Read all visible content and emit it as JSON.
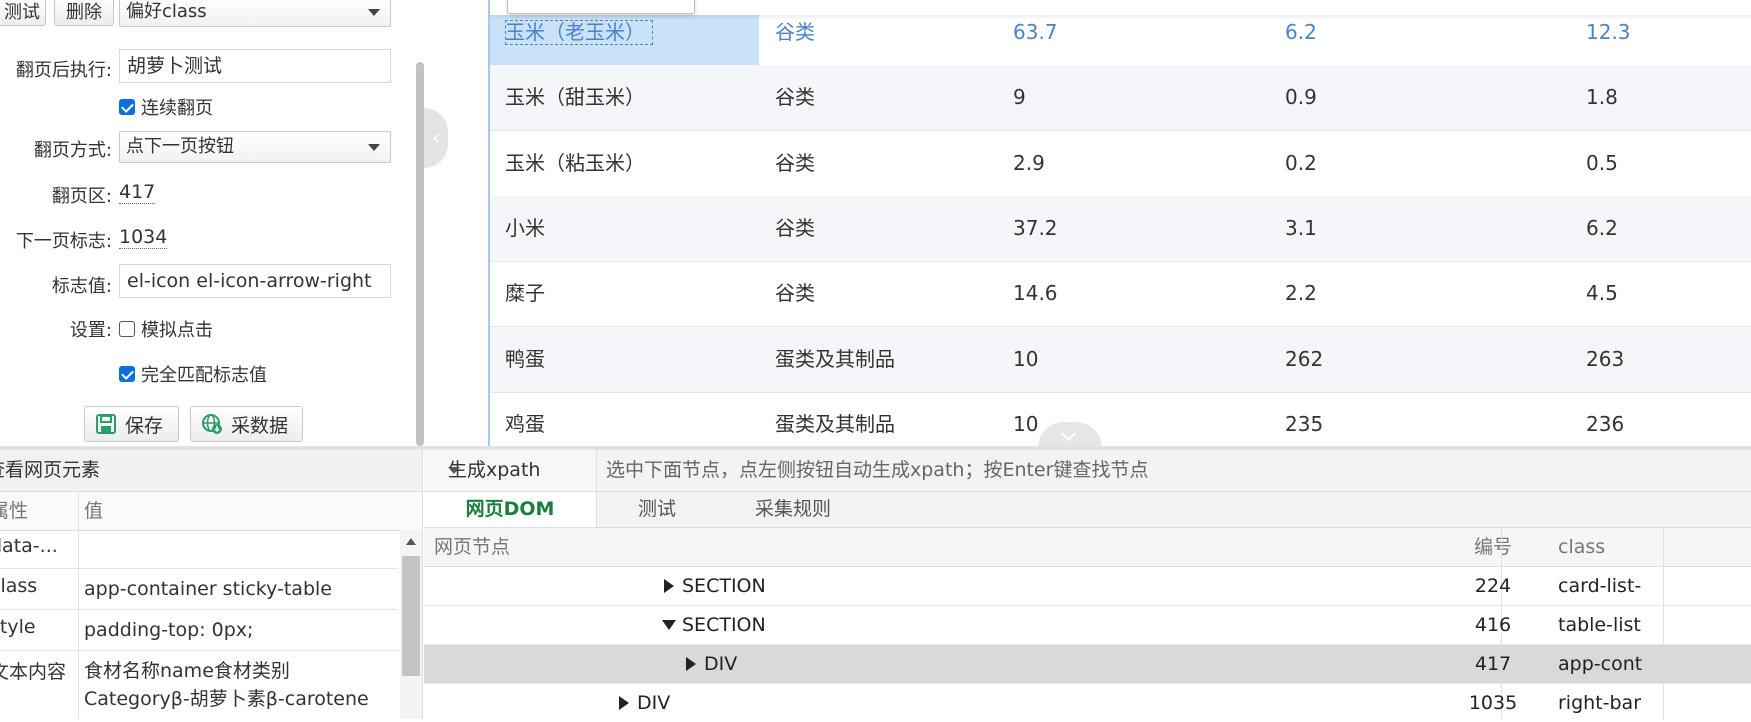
{
  "left_panel": {
    "test_button": "测试",
    "delete_button": "删除",
    "preference_select": "偏好class",
    "after_page_label": "翻页后执行:",
    "after_page_value": "胡萝卜测试",
    "continuous_label": "连续翻页",
    "page_method_label": "翻页方式:",
    "page_method_value": "点下一页按钮",
    "page_area_label": "翻页区:",
    "page_area_value": "417",
    "next_flag_label": "下一页标志:",
    "next_flag_value": "1034",
    "flag_value_label": "标志值:",
    "flag_value_value": "el-icon el-icon-arrow-right",
    "settings_label": "设置:",
    "simulate_click_label": "模拟点击",
    "exact_match_label": "完全匹配标志值",
    "save_button": "保存",
    "collect_button": "采数据"
  },
  "page_table": {
    "rows": [
      {
        "name": "玉米（老玉米）",
        "category": "谷类",
        "v1": "63.7",
        "v2": "6.2",
        "v3": "12.3"
      },
      {
        "name": "玉米（甜玉米）",
        "category": "谷类",
        "v1": "9",
        "v2": "0.9",
        "v3": "1.8"
      },
      {
        "name": "玉米（粘玉米）",
        "category": "谷类",
        "v1": "2.9",
        "v2": "0.2",
        "v3": "0.5"
      },
      {
        "name": "小米",
        "category": "谷类",
        "v1": "37.2",
        "v2": "3.1",
        "v3": "6.2"
      },
      {
        "name": "糜子",
        "category": "谷类",
        "v1": "14.6",
        "v2": "2.2",
        "v3": "4.5"
      },
      {
        "name": "鸭蛋",
        "category": "蛋类及其制品",
        "v1": "10",
        "v2": "262",
        "v3": "263"
      },
      {
        "name": "鸡蛋",
        "category": "蛋类及其制品",
        "v1": "10",
        "v2": "235",
        "v3": "236"
      }
    ]
  },
  "inspector": {
    "title": "查看网页元素",
    "col_attr": "属性",
    "col_value": "值",
    "rows": [
      {
        "key": "data-...",
        "value": ""
      },
      {
        "key": "class",
        "value": "app-container sticky-table"
      },
      {
        "key": "style",
        "value": "padding-top: 0px;"
      },
      {
        "key": "文本内容",
        "value": "食材名称name食材类别",
        "value2": "Categoryβ-胡萝卜素β-carotene"
      }
    ]
  },
  "dom_panel": {
    "xpath_select": "生成xpath",
    "xpath_hint": "选中下面节点，点左侧按钮自动生成xpath；按Enter键查找节点",
    "tabs": [
      "网页DOM",
      "测试",
      "采集规则"
    ],
    "col_node": "网页节点",
    "col_num": "编号",
    "col_class": "class",
    "nodes": [
      {
        "tag": "SECTION",
        "num": "224",
        "class": "card-list-"
      },
      {
        "tag": "SECTION",
        "num": "416",
        "class": "table-list"
      },
      {
        "tag": "DIV",
        "num": "417",
        "class": "app-cont"
      },
      {
        "tag": "DIV",
        "num": "1035",
        "class": "right-bar"
      }
    ]
  },
  "colors": {
    "accent_blue": "#0b6fe0",
    "selected_cell": "#c9e2f9",
    "active_tab_green": "#1a7f3c"
  }
}
